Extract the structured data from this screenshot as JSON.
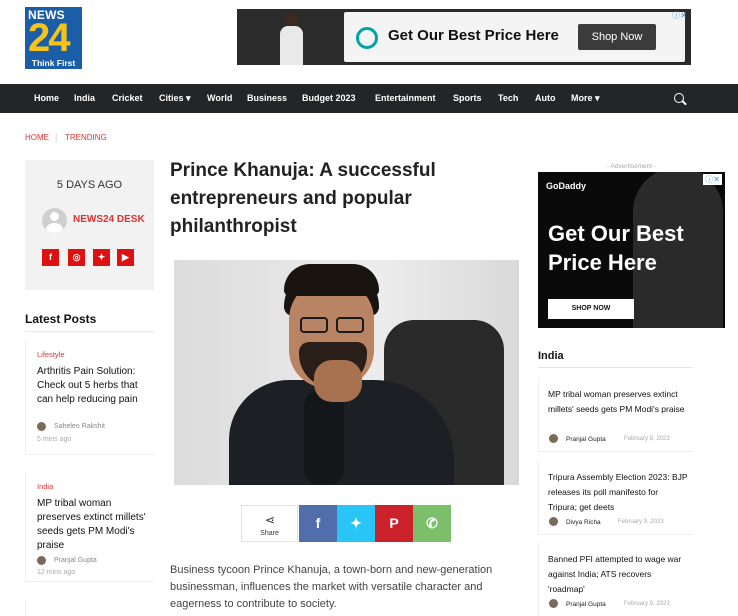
{
  "brand": {
    "logo_top": "NEWS",
    "logo_num": "24",
    "logo_tagline": "Think First"
  },
  "top_ad": {
    "text": "Get Our Best Price Here",
    "button": "Shop Now"
  },
  "nav": {
    "items": [
      "Home",
      "India",
      "Cricket",
      "Cities",
      "World",
      "Business",
      "Budget 2023",
      "Entertainment",
      "Sports",
      "Tech",
      "Auto",
      "More"
    ],
    "dropdown_items": [
      "Cities",
      "More"
    ]
  },
  "breadcrumb": {
    "home": "HOME",
    "current": "TRENDING"
  },
  "author_box": {
    "time_ago": "5 DAYS AGO",
    "author": "NEWS24 DESK",
    "social": [
      "f",
      "◎",
      "✦",
      "▶"
    ]
  },
  "latest": {
    "title": "Latest Posts",
    "posts": [
      {
        "category": "Lifestyle",
        "title": "Arthritis Pain Solution: Check out 5 herbs that can help reducing pain",
        "author": "Saheleo Rakshit",
        "time": "5 mins ago"
      },
      {
        "category": "India",
        "title": "MP tribal woman preserves extinct millets' seeds gets PM Modi's praise",
        "author": "Pranjal Gupta",
        "time": "12 mins ago"
      }
    ]
  },
  "article": {
    "headline": "Prince Khanuja: A successful entrepreneurs and popular philanthropist",
    "share_label": "Share",
    "excerpt": "Business tycoon Prince Khanuja, a town-born and new-generation businessman, influences the market with versatile character and eagerness to contribute to society."
  },
  "sidebar": {
    "ad_label": "- Advertisement -",
    "ad_brand": "GoDaddy",
    "ad_text": "Get Our Best Price Here",
    "ad_button": "SHOP NOW",
    "india_title": "India",
    "india_posts": [
      {
        "title": "MP tribal woman preserves extinct millets' seeds gets PM Modi's praise",
        "author": "Pranjal Gupta",
        "date": "February 9, 2023"
      },
      {
        "title": "Tripura Assembly Election 2023: BJP releases its poll manifesto for Tripura; get deets",
        "author": "Divya Richa",
        "date": "February 9, 2023"
      },
      {
        "title": "Banned PFI attempted to wage war against India; ATS recovers 'roadmap'",
        "author": "Pranjal Gupta",
        "date": "February 9, 2023"
      }
    ]
  },
  "colors": {
    "nav_bg": "#222629",
    "accent": "#dd3333",
    "facebook": "#516eab",
    "twitter": "#29c5f6",
    "pinterest": "#ca212a",
    "whatsapp": "#7bbf6a"
  }
}
